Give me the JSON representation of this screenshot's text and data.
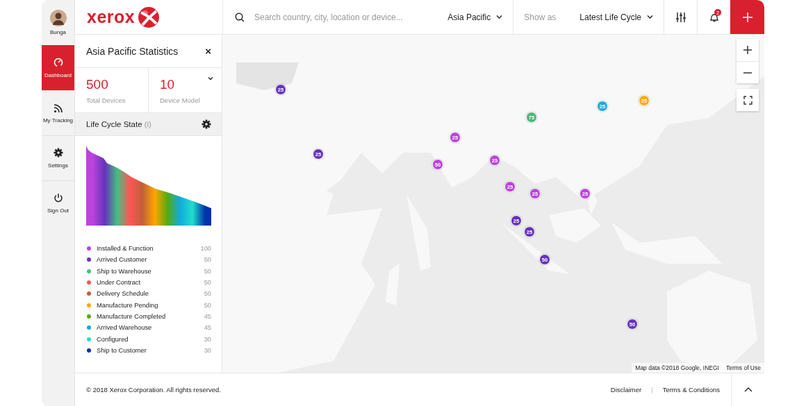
{
  "nav": {
    "user": {
      "name": "Bunga"
    },
    "items": [
      {
        "label": "Dashboard",
        "selected": true
      },
      {
        "label": "My Tracking",
        "selected": false
      },
      {
        "label": "Settings",
        "selected": false
      },
      {
        "label": "Sign Out",
        "selected": false
      }
    ]
  },
  "logo": {
    "text": "xerox"
  },
  "header": {
    "search": {
      "placeholder": "Search country, city, location or device..."
    },
    "region": "Asia Pacific",
    "show_as_label": "Show as",
    "show_as": "Latest Life Cycle",
    "notifications": "2"
  },
  "panel": {
    "title": "Asia Pacific Statistics",
    "close": "×",
    "stats": [
      {
        "value": "500",
        "label": "Total Devices"
      },
      {
        "value": "10",
        "label": "Device Model"
      }
    ],
    "section_title": "Life Cycle State",
    "section_info": "(i)",
    "legend": [
      {
        "label": "Installed & Function",
        "value": "100",
        "color": "#bb44dd"
      },
      {
        "label": "Arrived Customer",
        "value": "50",
        "color": "#6633bb"
      },
      {
        "label": "Ship to Warehouse",
        "value": "50",
        "color": "#44c080"
      },
      {
        "label": "Under Contract",
        "value": "50",
        "color": "#ff5555"
      },
      {
        "label": "Delivery Schedule",
        "value": "50",
        "color": "#c0603a"
      },
      {
        "label": "Manufacture Pending",
        "value": "50",
        "color": "#ffa500"
      },
      {
        "label": "Manufacture Completed",
        "value": "45",
        "color": "#55aa11"
      },
      {
        "label": "Arrived Warehouse",
        "value": "45",
        "color": "#11aadd"
      },
      {
        "label": "Configured",
        "value": "30",
        "color": "#22ddcc"
      },
      {
        "label": "Ship to Customer",
        "value": "30",
        "color": "#0033aa"
      }
    ]
  },
  "map": {
    "markers": [
      {
        "count": "25",
        "color": "#6633bb"
      },
      {
        "count": "25",
        "color": "#6633bb"
      },
      {
        "count": "25",
        "color": "#bb44dd"
      },
      {
        "count": "50",
        "color": "#bb44dd"
      },
      {
        "count": "25",
        "color": "#bb44dd"
      },
      {
        "count": "75",
        "color": "#44bb77"
      },
      {
        "count": "25",
        "color": "#22aadd"
      },
      {
        "count": "25",
        "color": "#ffaa11"
      },
      {
        "count": "25",
        "color": "#bb44dd"
      },
      {
        "count": "25",
        "color": "#bb44dd"
      },
      {
        "count": "25",
        "color": "#bb44dd"
      },
      {
        "count": "25",
        "color": "#6633bb"
      },
      {
        "count": "25",
        "color": "#6633bb"
      },
      {
        "count": "50",
        "color": "#6633bb"
      },
      {
        "count": "50",
        "color": "#6633bb"
      }
    ],
    "attribution": "Map data ©2018 Google, INEGI",
    "terms": "Terms of Use"
  },
  "footer": {
    "copyright": "© 2018 Xerox Corporation. All rights reserved.",
    "links": [
      "Disclaimer",
      "Terms & Conditions"
    ],
    "separator": "|"
  }
}
